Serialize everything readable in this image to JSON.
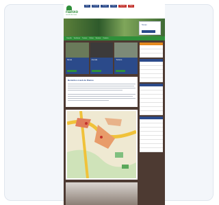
{
  "site": {
    "logo_text": "rianxo",
    "logo_subtitle": "concello de rianxo",
    "top_nav": [
      "Inicio",
      "Concello",
      "Turismo",
      "Cultura",
      "Deportes",
      "Mapa",
      "Contacto"
    ],
    "main_menu": [
      "Concello",
      "Veciñanza",
      "Turismo",
      "Cultura",
      "Servizos",
      "Contacto"
    ],
    "hero_box_title": "Tempo",
    "textbox_heading": "Benvidos á web de Rianxo",
    "teasers": [
      {
        "title": "Novas"
      },
      {
        "title": "Axenda"
      },
      {
        "title": "Turismo"
      }
    ]
  },
  "colors": {
    "brand_green": "#2f8f3a",
    "brand_blue": "#2b4a8a",
    "accent_red": "#c2322c",
    "accent_orange": "#e58a1f"
  }
}
